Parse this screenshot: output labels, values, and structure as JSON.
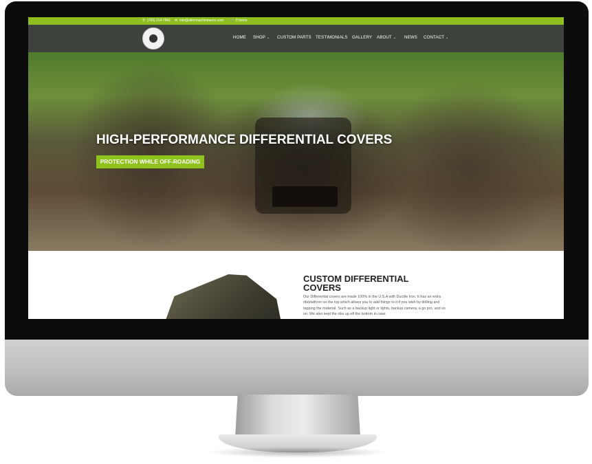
{
  "topbar": {
    "phone": "(760) 314-7841",
    "email": "info@allenmachinewors.com",
    "cart": "0 Items"
  },
  "nav": {
    "items": [
      {
        "label": "HOME",
        "dropdown": false
      },
      {
        "label": "SHOP",
        "dropdown": true
      },
      {
        "label": "CUSTOM PARTS",
        "dropdown": false
      },
      {
        "label": "TESTIMONIALS",
        "dropdown": false
      },
      {
        "label": "GALLERY",
        "dropdown": false
      },
      {
        "label": "ABOUT",
        "dropdown": true
      },
      {
        "label": "NEWS",
        "dropdown": false
      },
      {
        "label": "CONTACT",
        "dropdown": true
      }
    ]
  },
  "hero": {
    "title": "HIGH-PERFORMANCE DIFFERENTIAL COVERS",
    "button": "PROTECTION WHILE OFF-ROADING"
  },
  "section": {
    "title": "CUSTOM DIFFERENTIAL COVERS",
    "body": "Our Differential covers are made 100% in the U.S.A with Ductile Iron. It has an extra rib/platform on the top which allows you to add things to it if you wish by drilling and tapping the material. Such as a backup light or lights, backup camera, a go pro, and so on. We also kept the ribs up off the bottom in case"
  },
  "colors": {
    "accent": "#8fc21c",
    "nav_bg": "#14180f"
  }
}
